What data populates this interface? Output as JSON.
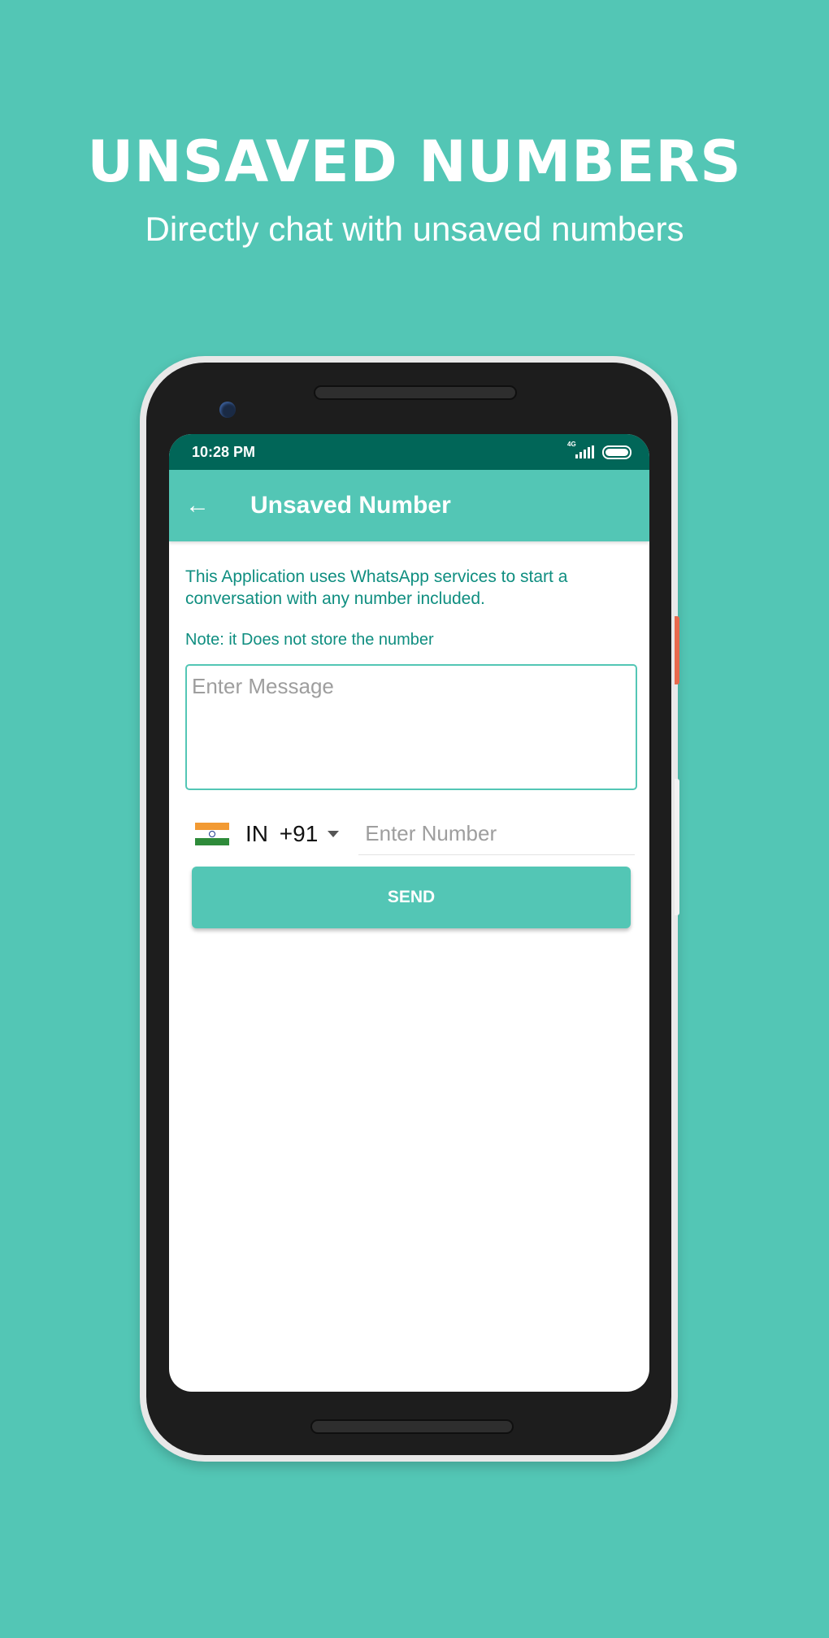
{
  "promo": {
    "title": "UNSAVED NUMBERS",
    "subtitle": "Directly chat with unsaved numbers"
  },
  "status_bar": {
    "time": "10:28 PM",
    "network": "4G",
    "icons": [
      "signal-icon",
      "battery-icon"
    ]
  },
  "app_bar": {
    "back_icon": "arrow-left-icon",
    "title": "Unsaved Number"
  },
  "main": {
    "info": "This Application uses WhatsApp services to start a conversation with any number included.",
    "note": "Note: it Does not store the number",
    "message_placeholder": "Enter Message",
    "country": {
      "code": "IN",
      "dial": "+91",
      "flag_icon": "india-flag-icon"
    },
    "number_placeholder": "Enter Number",
    "send_label": "SEND"
  },
  "colors": {
    "background": "#53c6b5",
    "status_bar": "#016658",
    "text_accent": "#0f8e80"
  }
}
